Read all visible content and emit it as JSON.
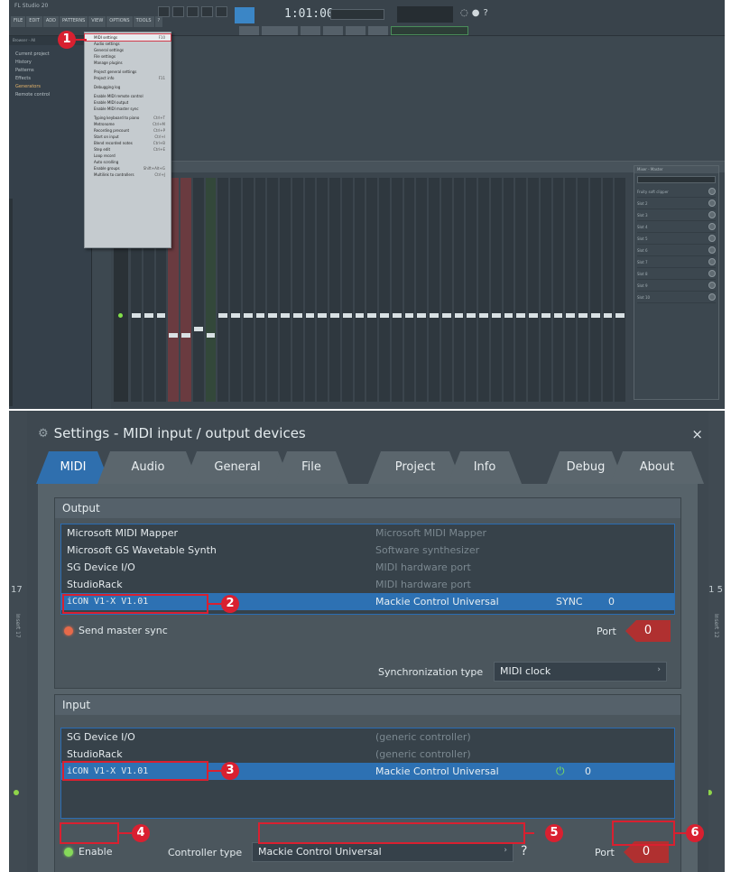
{
  "top": {
    "window_title": "FL Studio 20",
    "menu": [
      "FILE",
      "EDIT",
      "ADD",
      "PATTERNS",
      "VIEW",
      "OPTIONS",
      "TOOLS",
      "?"
    ],
    "tempo": "1:01:00",
    "browser_header": "Browser - All",
    "browser_items": [
      "Current project",
      "History",
      "Patterns",
      "Effects",
      "Generators",
      "Remote control"
    ],
    "options_menu": [
      {
        "label": "MIDI settings",
        "shortcut": "F10",
        "selected": true
      },
      {
        "label": "Audio settings",
        "shortcut": ""
      },
      {
        "label": "General settings",
        "shortcut": ""
      },
      {
        "label": "File settings",
        "shortcut": ""
      },
      {
        "label": "Manage plugins",
        "shortcut": ""
      },
      {
        "label": "",
        "sep": true
      },
      {
        "label": "Project general settings",
        "shortcut": ""
      },
      {
        "label": "Project info",
        "shortcut": "F11"
      },
      {
        "label": "",
        "sep": true
      },
      {
        "label": "Debugging log",
        "shortcut": ""
      },
      {
        "label": "",
        "sep": true
      },
      {
        "label": "Enable MIDI remote control",
        "shortcut": ""
      },
      {
        "label": "Enable MIDI output",
        "shortcut": ""
      },
      {
        "label": "Enable MIDI master sync",
        "shortcut": ""
      },
      {
        "label": "",
        "sep": true
      },
      {
        "label": "Typing keyboard to piano",
        "shortcut": "Ctrl+T"
      },
      {
        "label": "Metronome",
        "shortcut": "Ctrl+M"
      },
      {
        "label": "Recording precount",
        "shortcut": "Ctrl+P"
      },
      {
        "label": "Start on input",
        "shortcut": "Ctrl+I"
      },
      {
        "label": "Blend recorded notes",
        "shortcut": "Ctrl+B"
      },
      {
        "label": "Step edit",
        "shortcut": "Ctrl+E"
      },
      {
        "label": "Loop record",
        "shortcut": ""
      },
      {
        "label": "Auto scrolling",
        "shortcut": ""
      },
      {
        "label": "Enable groups",
        "shortcut": "Shift+Alt+G"
      },
      {
        "label": "Multilink to controllers",
        "shortcut": "Ctrl+J"
      }
    ],
    "fx_header": "Mixer - Master",
    "fx_slots": [
      "Fruity soft clipper",
      "Slot 2",
      "Slot 3",
      "Slot 4",
      "Slot 5",
      "Slot 6",
      "Slot 7",
      "Slot 8",
      "Slot 9",
      "Slot 10"
    ]
  },
  "dialog": {
    "title": "Settings - MIDI input / output devices",
    "close": "×",
    "tabs": [
      "MIDI",
      "Audio",
      "General",
      "File",
      "Project",
      "Info",
      "Debug",
      "About"
    ],
    "active_tab": "MIDI",
    "output": {
      "header": "Output",
      "devices": [
        {
          "name": "Microsoft MIDI Mapper",
          "desc": "Microsoft MIDI Mapper",
          "sync": "",
          "port": ""
        },
        {
          "name": "Microsoft GS Wavetable Synth",
          "desc": "Software synthesizer",
          "sync": "",
          "port": ""
        },
        {
          "name": "SG Device I/O",
          "desc": "MIDI hardware port",
          "sync": "",
          "port": ""
        },
        {
          "name": "StudioRack",
          "desc": "MIDI hardware port",
          "sync": "",
          "port": ""
        },
        {
          "name": "iCON V1-X V1.01",
          "desc": "Mackie Control Universal",
          "sync": "SYNC",
          "port": "0",
          "selected": true
        }
      ],
      "send_master_sync": "Send master sync",
      "port_label": "Port",
      "port_value": "0",
      "sync_type_label": "Synchronization type",
      "sync_type_value": "MIDI clock"
    },
    "input": {
      "header": "Input",
      "devices": [
        {
          "name": "SG Device I/O",
          "desc": "(generic controller)",
          "port": ""
        },
        {
          "name": "StudioRack",
          "desc": "(generic controller)",
          "port": ""
        },
        {
          "name": "iCON V1-X V1.01",
          "desc": "Mackie Control Universal",
          "port": "0",
          "selected": true
        }
      ],
      "enable": "Enable",
      "controller_type_label": "Controller type",
      "controller_type_value": "Mackie Control Universal",
      "help": "?",
      "port_label": "Port",
      "port_value": "0"
    }
  },
  "side_labels": {
    "left_num": "17",
    "right_num": "1 5",
    "left_text": "Insert 17",
    "right_text": "Insert 12"
  },
  "callouts": [
    "1",
    "2",
    "3",
    "4",
    "5",
    "6"
  ]
}
